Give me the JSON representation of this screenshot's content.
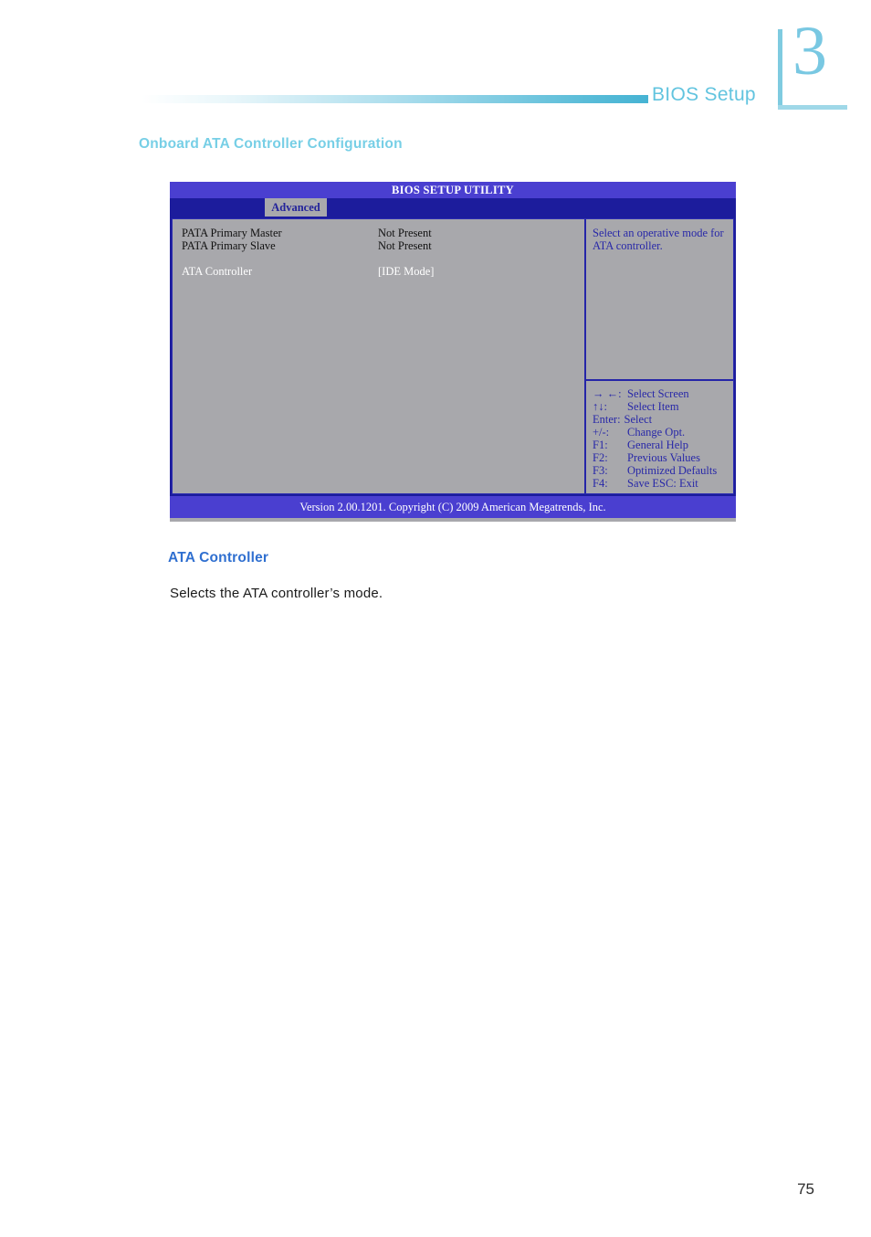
{
  "header": {
    "chapter_number": "3",
    "title": "BIOS Setup"
  },
  "section": {
    "title": "Onboard ATA Controller Configuration"
  },
  "bios": {
    "window_title": "BIOS SETUP UTILITY",
    "active_tab": "Advanced",
    "settings": [
      {
        "label": "PATA Primary Master",
        "value": "Not Present",
        "selected": false
      },
      {
        "label": "PATA Primary Slave",
        "value": "Not Present",
        "selected": false
      },
      {
        "label": "ATA Controller",
        "value": "[IDE Mode]",
        "selected": true
      }
    ],
    "rows": {
      "r0_label": "PATA Primary Master",
      "r0_value": "Not Present",
      "r1_label": "PATA Primary Slave",
      "r1_value": "Not Present",
      "r2_label": "ATA Controller",
      "r2_value": "[IDE Mode]"
    },
    "help_text": "Select an operative mode for ATA controller.",
    "legend": [
      {
        "key": "→ ←:",
        "value": "Select Screen"
      },
      {
        "key": "↑↓:",
        "value": "Select Item"
      },
      {
        "key": "Enter:",
        "value": "Select"
      },
      {
        "key": "+/-:",
        "value": "Change Opt."
      },
      {
        "key": "F1:",
        "value": "General Help"
      },
      {
        "key": "F2:",
        "value": "Previous Values"
      },
      {
        "key": "F3:",
        "value": "Optimized Defaults"
      },
      {
        "key": "F4:",
        "value": "Save   ESC: Exit"
      }
    ],
    "legend_flat": {
      "k0": "→ ←:",
      "v0": "Select Screen",
      "k1": "↑↓:",
      "v1": "Select Item",
      "k2": "Enter:",
      "v2": "Select",
      "k3": "+/-:",
      "v3": "Change Opt.",
      "k4": "F1:",
      "v4": "General Help",
      "k5": "F2:",
      "v5": "Previous Values",
      "k6": "F3:",
      "v6": "Optimized Defaults",
      "k7": "F4:",
      "v7": "Save   ESC: Exit"
    },
    "footer": "Version 2.00.1201. Copyright (C) 2009 American Megatrends, Inc."
  },
  "content": {
    "subheading": "ATA Controller",
    "description": "Selects the ATA controller’s mode."
  },
  "page": {
    "number": "75"
  },
  "colors": {
    "accent_cyan": "#62c4df",
    "section_title": "#77cfe6",
    "subheading_blue": "#2f6fd0",
    "bios_titlebar": "#4a3fd0",
    "bios_tabbar": "#1c1c9c",
    "bios_panel_gray": "#a8a8ac",
    "bios_text_blue": "#2828a8"
  }
}
